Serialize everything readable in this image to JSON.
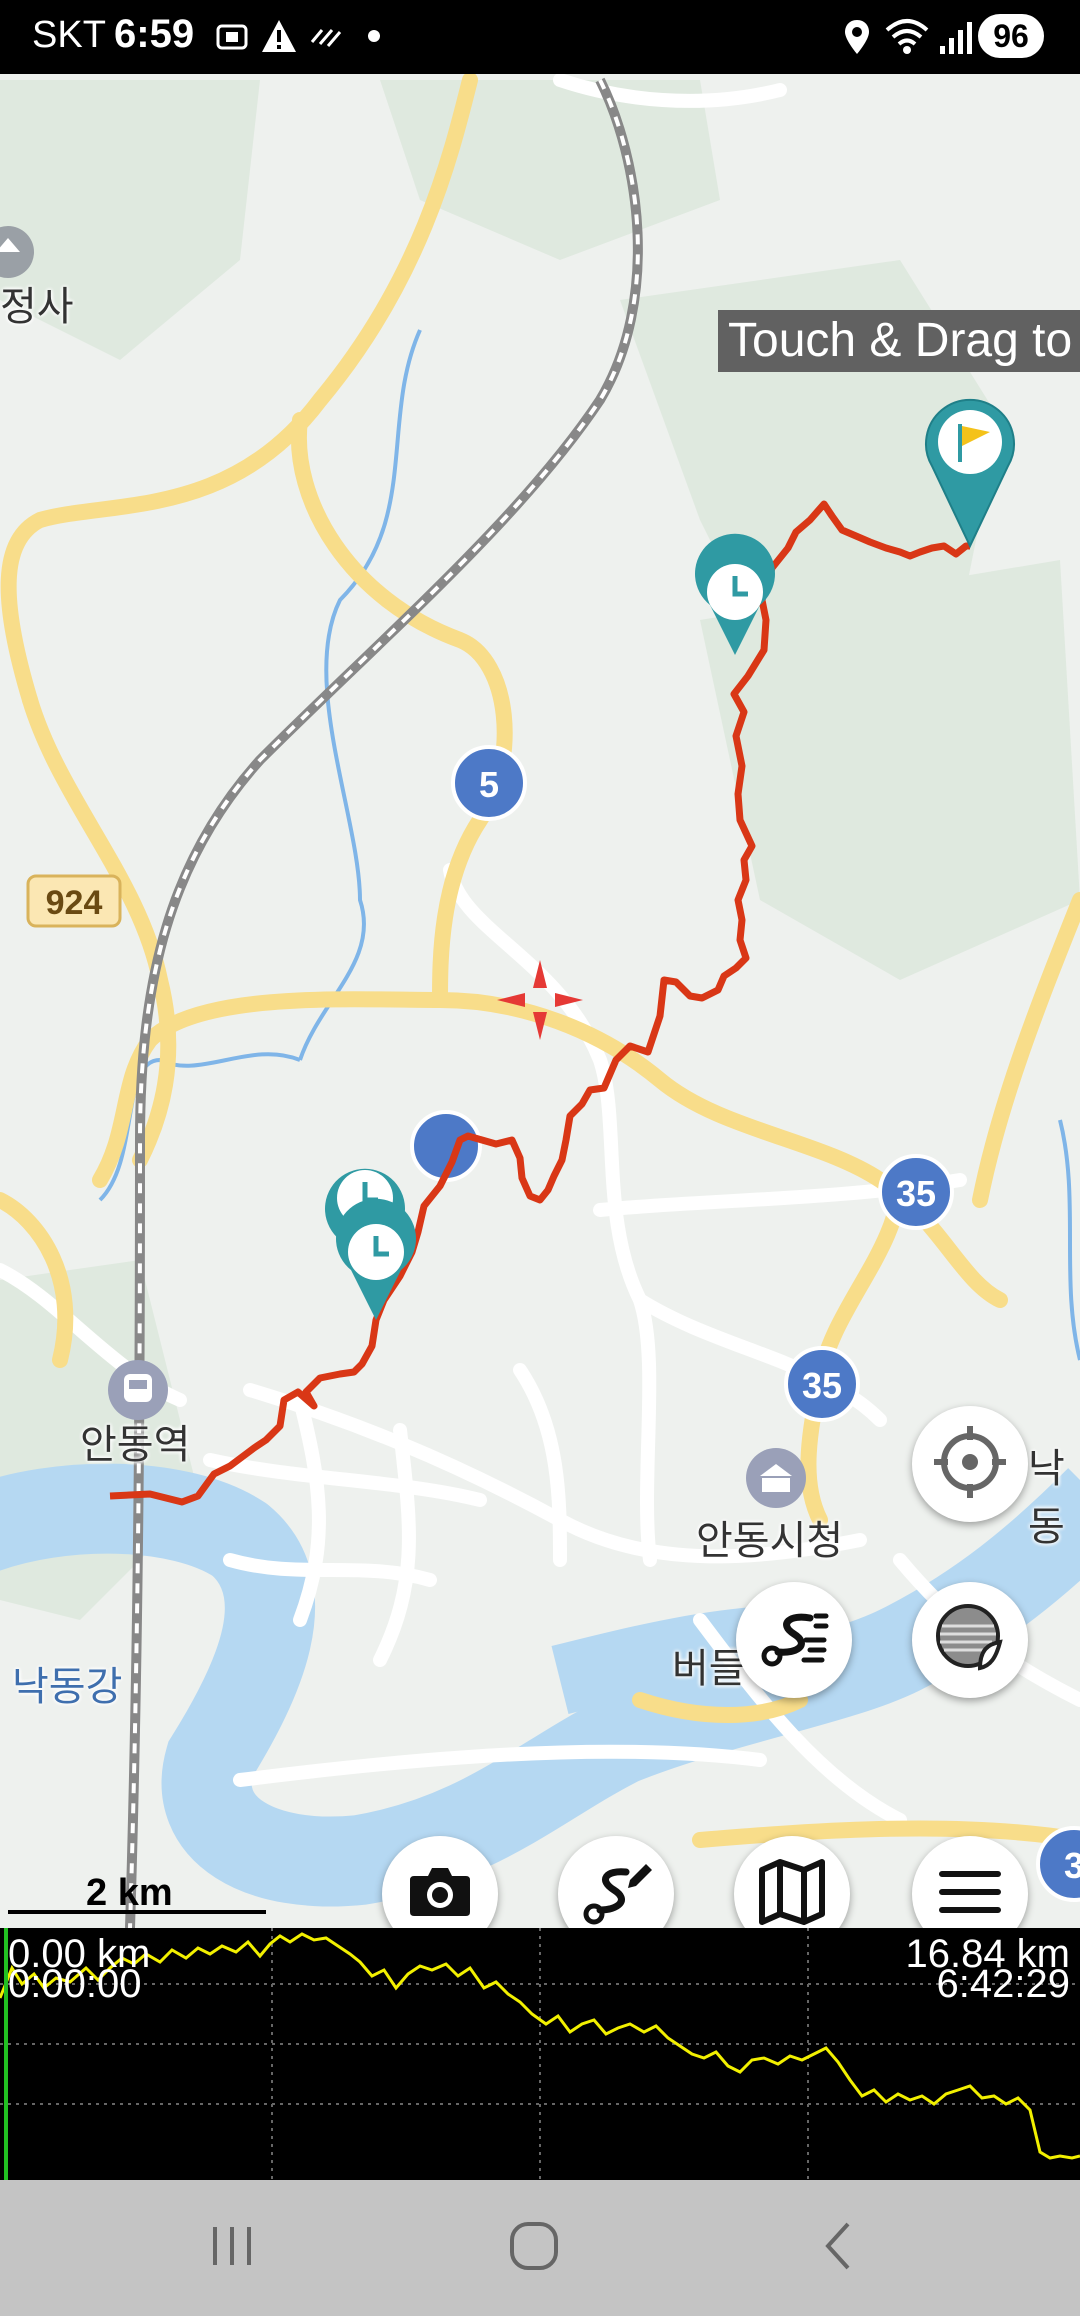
{
  "status_bar": {
    "carrier": "SKT",
    "time": "6:59",
    "battery": "96",
    "icons": [
      "screenshot-icon",
      "warning-icon",
      "data-icon",
      "dot-icon",
      "location-icon",
      "wifi-icon",
      "signal-icon"
    ]
  },
  "map": {
    "tooltip": "Touch & Drag to",
    "place_labels": {
      "temple": "정사",
      "station": "안동역",
      "city_hall": "안동시청",
      "river": "낙동강",
      "area_right": "낙동",
      "area_bottom": "버들"
    },
    "route_shields": {
      "r5": "5",
      "r924": "924",
      "r35a": "35",
      "r35b": "35",
      "r3": "3"
    },
    "scale_label": "2 km"
  },
  "fab_buttons": [
    "recenter-button",
    "layers-button",
    "track-list-button",
    "camera-button",
    "draw-route-button",
    "map-button",
    "menu-button"
  ],
  "elevation_profile": {
    "start_distance": "0.00 km",
    "start_time": "0:00:00",
    "end_distance": "16.84 km",
    "end_time": "6:42:29",
    "line_color": "#f2f000"
  },
  "nav_bar": [
    "recent-apps-button",
    "home-button",
    "back-button"
  ]
}
